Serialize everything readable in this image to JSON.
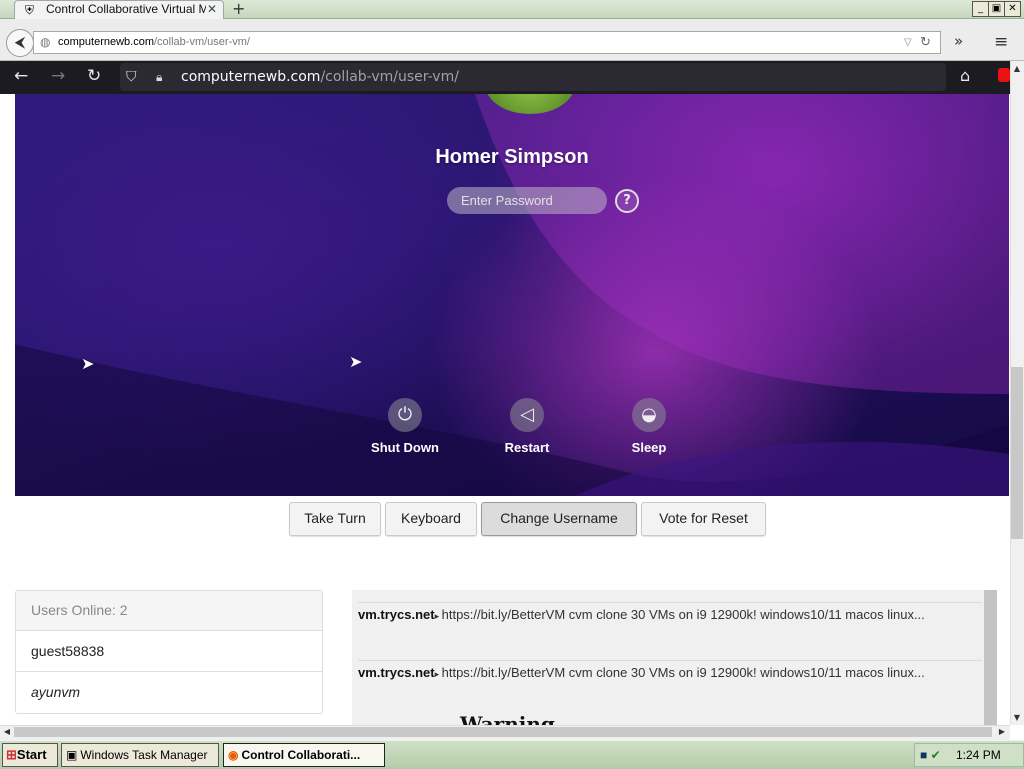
{
  "outer_window": {
    "tab_title": "Control Collaborative Virtual M...",
    "tab_close": "✕",
    "new_tab": "+",
    "min": "_",
    "max": "▣",
    "close": "✕"
  },
  "outer_nav": {
    "url_domain": "computernewb.com",
    "url_path": "/collab-vm/user-vm/",
    "more": "»",
    "menu": "≡"
  },
  "inner_nav": {
    "url_domain": "computernewb.com",
    "url_path": "/collab-vm/user-vm/"
  },
  "vm": {
    "username": "Homer Simpson",
    "password_placeholder": "Enter Password",
    "help": "?",
    "power": [
      {
        "label": "Shut Down",
        "icon": "⏻"
      },
      {
        "label": "Restart",
        "icon": "◁"
      },
      {
        "label": "Sleep",
        "icon": "◒"
      }
    ]
  },
  "controls": {
    "take_turn": "Take Turn",
    "keyboard": "Keyboard",
    "change_username": "Change Username",
    "vote_reset": "Vote for Reset"
  },
  "users": {
    "header": "Users Online: 2",
    "list": [
      "guest58838",
      "ayunvm"
    ]
  },
  "chat": {
    "messages": [
      {
        "user": "vm.trycs.net",
        "text": "https://bit.ly/BetterVM cvm clone 30 VMs on i9 12900k! windows10/11 macos linux..."
      },
      {
        "user": "vm.trycs.net",
        "text": "https://bit.ly/BetterVM cvm clone 30 VMs on i9 12900k! windows10/11 macos linux..."
      }
    ],
    "warning": "Warning"
  },
  "taskbar": {
    "start": "Start",
    "tasks": [
      "Windows Task Manager",
      "Control Collaborati..."
    ],
    "clock": "1:24 PM"
  }
}
